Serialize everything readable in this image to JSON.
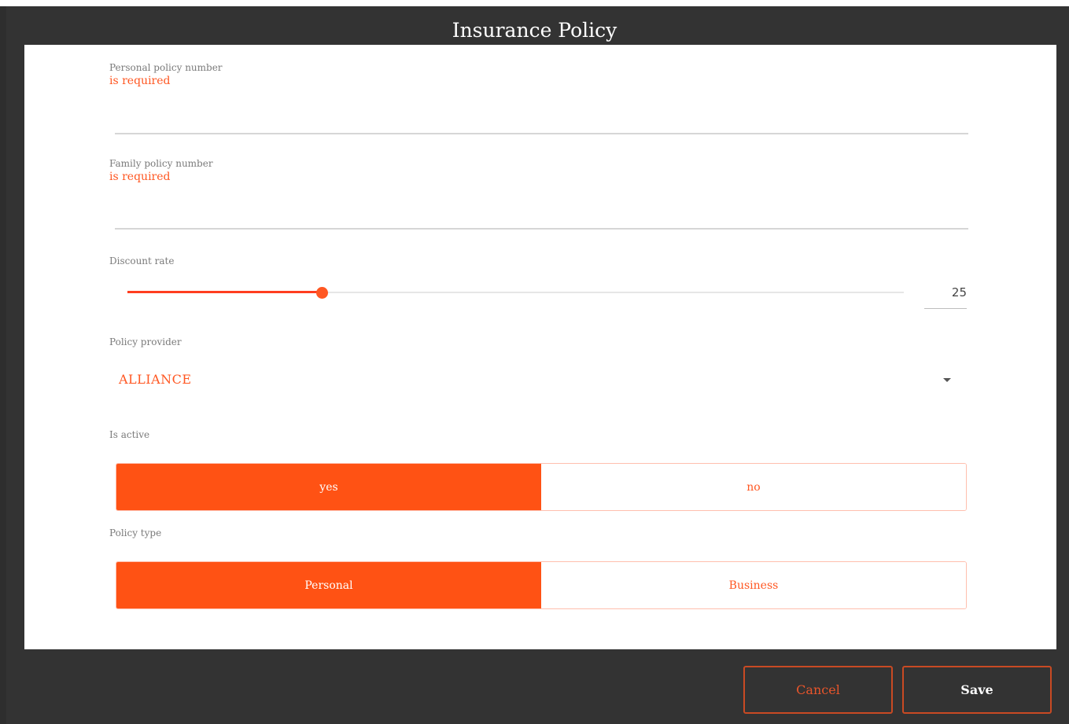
{
  "dialog": {
    "title": "Insurance Policy"
  },
  "form": {
    "personal_policy": {
      "label": "Personal policy number",
      "error": "is required",
      "value": ""
    },
    "family_policy": {
      "label": "Family policy number",
      "error": "is required",
      "value": ""
    },
    "discount_rate": {
      "label": "Discount rate",
      "value": "25",
      "fraction": 0.25
    },
    "policy_provider": {
      "label": "Policy provider",
      "selected": "ALLIANCE"
    },
    "is_active": {
      "label": "Is active",
      "options": [
        "yes",
        "no"
      ],
      "selected": "yes"
    },
    "policy_type": {
      "label": "Policy type",
      "options": [
        "Personal",
        "Business"
      ],
      "selected": "Personal"
    }
  },
  "footer": {
    "cancel_label": "Cancel",
    "save_label": "Save"
  },
  "colors": {
    "accent": "#ff5722",
    "background": "#333333",
    "card": "#ffffff"
  },
  "icons": {
    "provider_dropdown": "caret-down-icon"
  }
}
